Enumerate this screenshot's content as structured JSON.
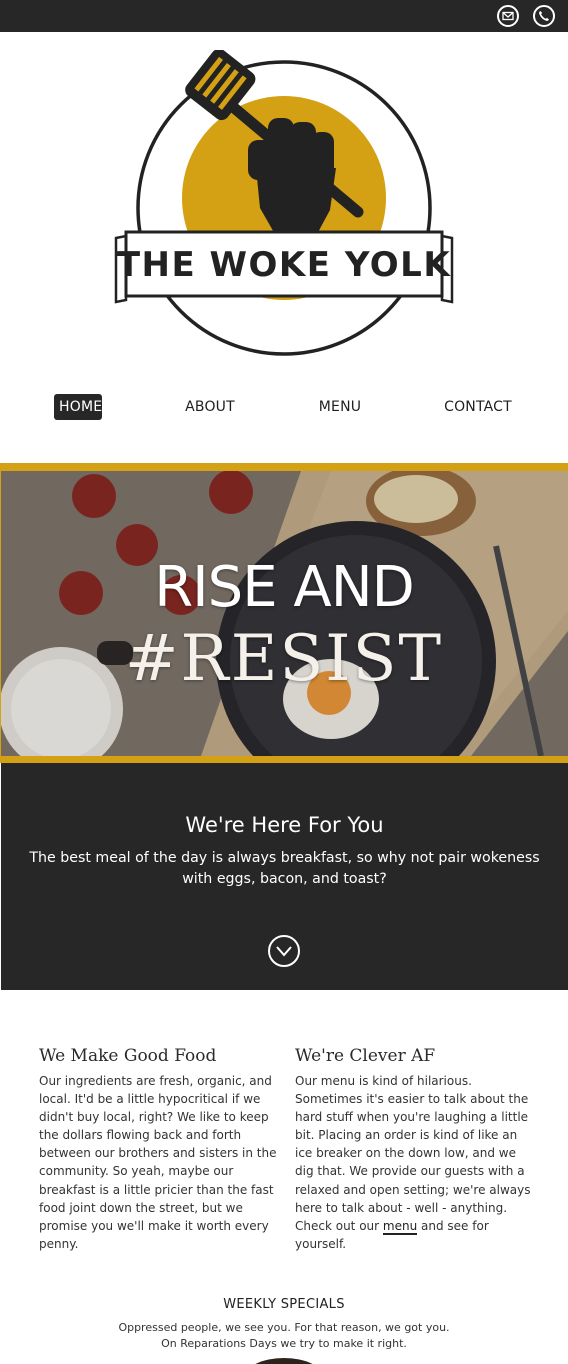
{
  "topbar": {
    "email_icon": "envelope-icon",
    "phone_icon": "phone-icon",
    "background": "#282728"
  },
  "logo": {
    "brand": "THE WOKE YOLK",
    "accent": "#d4a014"
  },
  "nav": {
    "items": [
      {
        "label": "HOME",
        "active": true
      },
      {
        "label": "ABOUT",
        "active": false
      },
      {
        "label": "MENU",
        "active": false
      },
      {
        "label": "CONTACT",
        "active": false
      }
    ]
  },
  "hero": {
    "line1": "RISE AND",
    "line2": "#RESIST",
    "border_color": "#d4a014"
  },
  "intro": {
    "heading": "We're Here For You",
    "text": "The best meal of the day is always breakfast, so why not pair wokeness with eggs, bacon, and toast?",
    "scroll_icon": "chevron-down-icon"
  },
  "features": [
    {
      "title": "We Make Good Food",
      "text": "Our ingredients are fresh, organic, and local. It'd be a little hypocritical if we didn't buy local, right? We like to keep the dollars flowing back and forth between our brothers and sisters in the community. So yeah, maybe our breakfast is a little pricier than the fast food joint down the street, but we promise you we'll make it worth every penny."
    },
    {
      "title": "We're Clever AF",
      "text": "Our menu is kind of hilarious. Sometimes it's easier to talk about the hard stuff when you're laughing a little bit. Placing an order is kind of like an ice breaker on the down low, and we dig that. We provide our guests with a relaxed and open setting; we're always here to talk about - well - anything. Check out our",
      "link_text": "menu",
      "text_after": "and see for yourself."
    }
  ],
  "specials": {
    "title": "WEEKLY SPECIALS",
    "text": "Oppressed people, we see you. For that reason, we got you. On Reparations Days we try to make it right."
  }
}
